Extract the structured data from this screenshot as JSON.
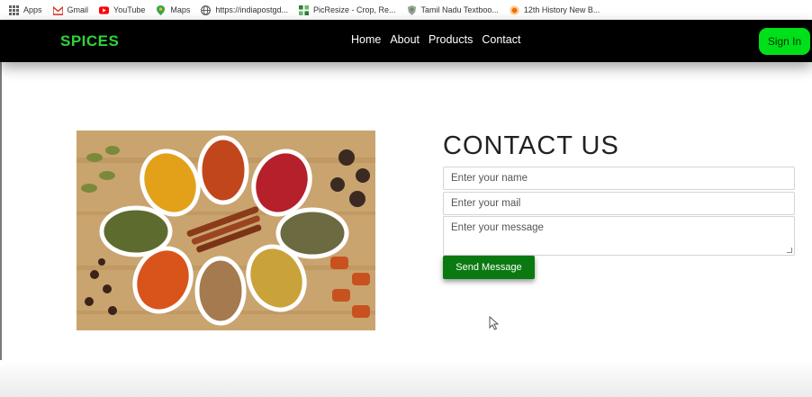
{
  "bookmarks": [
    {
      "label": "Apps",
      "icon": "apps-grid-icon"
    },
    {
      "label": "Gmail",
      "icon": "gmail-icon"
    },
    {
      "label": "YouTube",
      "icon": "youtube-icon"
    },
    {
      "label": "Maps",
      "icon": "maps-icon"
    },
    {
      "label": "https://indiapostgd...",
      "icon": "globe-icon"
    },
    {
      "label": "PicResize - Crop, Re...",
      "icon": "picresize-icon"
    },
    {
      "label": "Tamil Nadu Textboo...",
      "icon": "shield-icon"
    },
    {
      "label": "12th History New B...",
      "icon": "book-icon"
    }
  ],
  "navbar": {
    "logo": "SPICES",
    "links": [
      "Home",
      "About",
      "Products",
      "Contact"
    ],
    "signin_label": "Sign In"
  },
  "contact": {
    "title": "CONTACT US",
    "name_placeholder": "Enter your name",
    "mail_placeholder": "Enter your mail",
    "message_placeholder": "Enter your message",
    "send_label": "Send Message"
  },
  "colors": {
    "accent": "#2fd33a",
    "signin_bg": "#00e01a",
    "send_bg": "#0a7a10",
    "navbar_bg": "#000000"
  }
}
